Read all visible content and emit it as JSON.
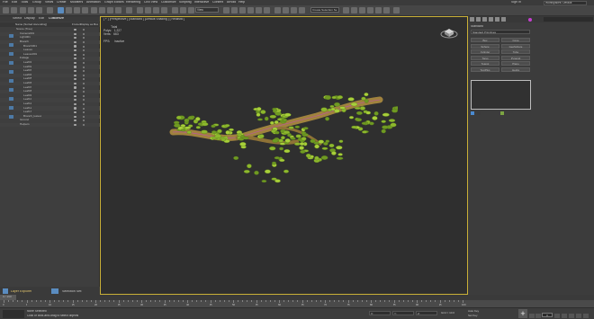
{
  "menu": {
    "items": [
      "File",
      "Edit",
      "Tools",
      "Group",
      "Views",
      "Create",
      "Modifiers",
      "Animation",
      "Graph Editors",
      "Rendering",
      "Civil View",
      "Customize",
      "Scripting",
      "Interactive",
      "Content",
      "Arnold",
      "Help"
    ],
    "sign_in": "Sign In",
    "workspace_label": "Workspaces: Default"
  },
  "toolbar": {
    "view_dropdown": "View",
    "selection_set": "Create Selection Se"
  },
  "explorer": {
    "tabs": [
      "Select",
      "Display",
      "Edit",
      "Customize"
    ],
    "column_headers": [
      "Name (Sorted Ascending)",
      "Frozen",
      "Display as Box"
    ],
    "rows": [
      {
        "name": "Scene (Tree)",
        "indent": 0
      },
      {
        "name": "Camera001",
        "indent": 1
      },
      {
        "name": "Light001",
        "indent": 1
      },
      {
        "name": "Branch",
        "indent": 1
      },
      {
        "name": "Branch001",
        "indent": 2
      },
      {
        "name": "Leaves",
        "indent": 2
      },
      {
        "name": "Leaves001",
        "indent": 2
      },
      {
        "name": "Foliage",
        "indent": 1
      },
      {
        "name": "Leaf01",
        "indent": 2
      },
      {
        "name": "Leaf02",
        "indent": 2
      },
      {
        "name": "Leaf03",
        "indent": 2
      },
      {
        "name": "Leaf04",
        "indent": 2
      },
      {
        "name": "Leaf05",
        "indent": 2
      },
      {
        "name": "Leaf06",
        "indent": 2
      },
      {
        "name": "Leaf07",
        "indent": 2
      },
      {
        "name": "Leaf08",
        "indent": 2
      },
      {
        "name": "Leaf09",
        "indent": 2
      },
      {
        "name": "Leaf10",
        "indent": 2
      },
      {
        "name": "Leaf11",
        "indent": 2
      },
      {
        "name": "Leaf12",
        "indent": 2
      },
      {
        "name": "Leaf13",
        "indent": 2
      },
      {
        "name": "Branch_leaves",
        "indent": 2
      },
      {
        "name": "Ground",
        "indent": 1
      },
      {
        "name": "Helpers",
        "indent": 1
      }
    ],
    "layer_label": "Layer Explorer",
    "selection_label": "Selection Set:"
  },
  "viewport": {
    "label": "[ + ] [Perspective ] [Standard ] [Default Shading ] [ Realistic ]",
    "stats": "         Total\nPolys:   1,227\nVerts:   663\n\nFPS:     Inactive"
  },
  "command_panel": {
    "heading": "Standard",
    "dropdown": "Standard Primitives",
    "buttons": [
      "Box",
      "Cone",
      "Sphere",
      "GeoSphere",
      "Cylinder",
      "Tube",
      "Torus",
      "Pyramid",
      "Teapot",
      "Plane",
      "TextPlus",
      "Hedra"
    ],
    "swatch_colors": [
      "#4a8ad0",
      "#3a3a3a",
      "#7ca442"
    ]
  },
  "timeline": {
    "frame_label": "0 / 100",
    "tick_labels": [
      "0",
      "5",
      "10",
      "15",
      "20",
      "25",
      "30",
      "35",
      "40",
      "45",
      "50",
      "55",
      "60",
      "65",
      "70",
      "75",
      "80",
      "85",
      "90",
      "95",
      "100"
    ]
  },
  "status": {
    "line1": "None Selected",
    "line2": "Click or click-and-drag to select objects",
    "coords": [
      "X:",
      "Y:",
      "Z:"
    ],
    "grid": "Grid = 10.0",
    "autokey": "Auto Key",
    "setkey": "Set Key",
    "frame": "0"
  },
  "colors": {
    "accent": "#c9b037",
    "leaf": "#8db82d",
    "branch": "#a0823e",
    "selection": "#c540d0"
  }
}
